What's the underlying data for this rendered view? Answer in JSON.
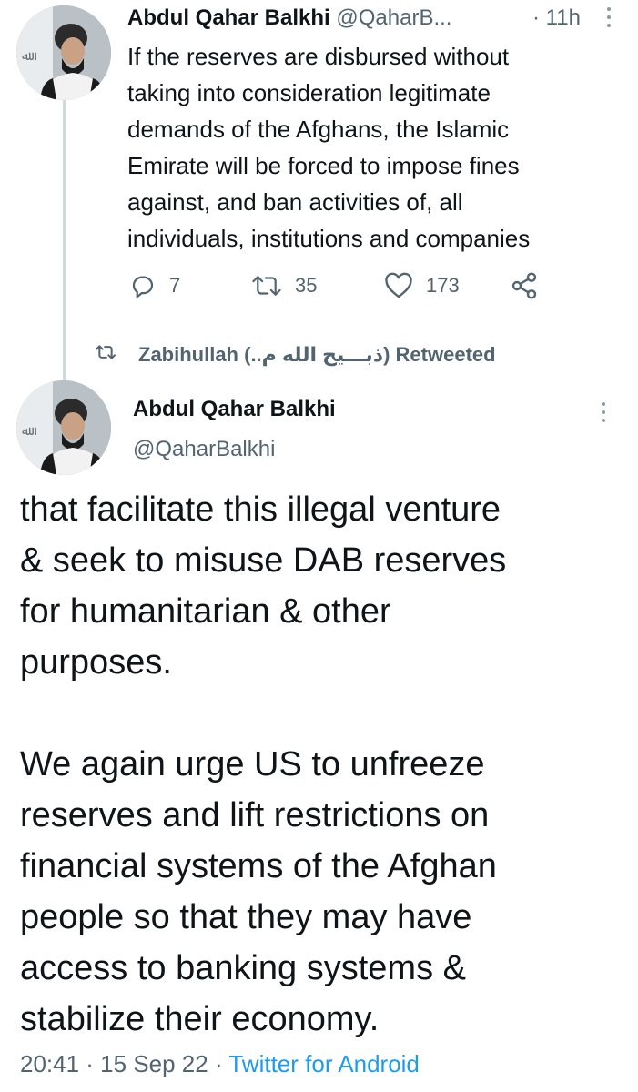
{
  "tweet1": {
    "author_name": "Abdul Qahar Balkhi",
    "handle_truncated": "@QaharB...",
    "time": "· 11h",
    "body": "If the reserves are disbursed without\ntaking into consideration legitimate\ndemands of the Afghans, the Islamic\nEmirate will be forced to impose fines\nagainst, and ban activities of, all\nindividuals, institutions and companies",
    "actions": {
      "reply_count": "7",
      "retweet_count": "35",
      "like_count": "173"
    }
  },
  "retweet_bar": {
    "text": "Zabihullah (..ذبـــيح الله م) Retweeted"
  },
  "tweet2": {
    "author_name": "Abdul Qahar Balkhi",
    "handle": "@QaharBalkhi",
    "body": "that facilitate this illegal venture\n& seek to misuse DAB reserves\nfor humanitarian & other\npurposes.\n\nWe again urge US to unfreeze\nreserves and lift restrictions on\nfinancial systems of the Afghan\npeople so that they may have\naccess to banking systems &\nstabilize their economy.",
    "timestamp": "20:41 · 15 Sep 22 · ",
    "source": "Twitter for Android"
  },
  "colors": {
    "text": "#0f1419",
    "muted": "#536471",
    "link": "#1d9bf0",
    "thread_line": "#cfd9de"
  },
  "icons": [
    "reply-icon",
    "retweet-icon",
    "like-icon",
    "share-icon",
    "more-icon",
    "avatar"
  ]
}
